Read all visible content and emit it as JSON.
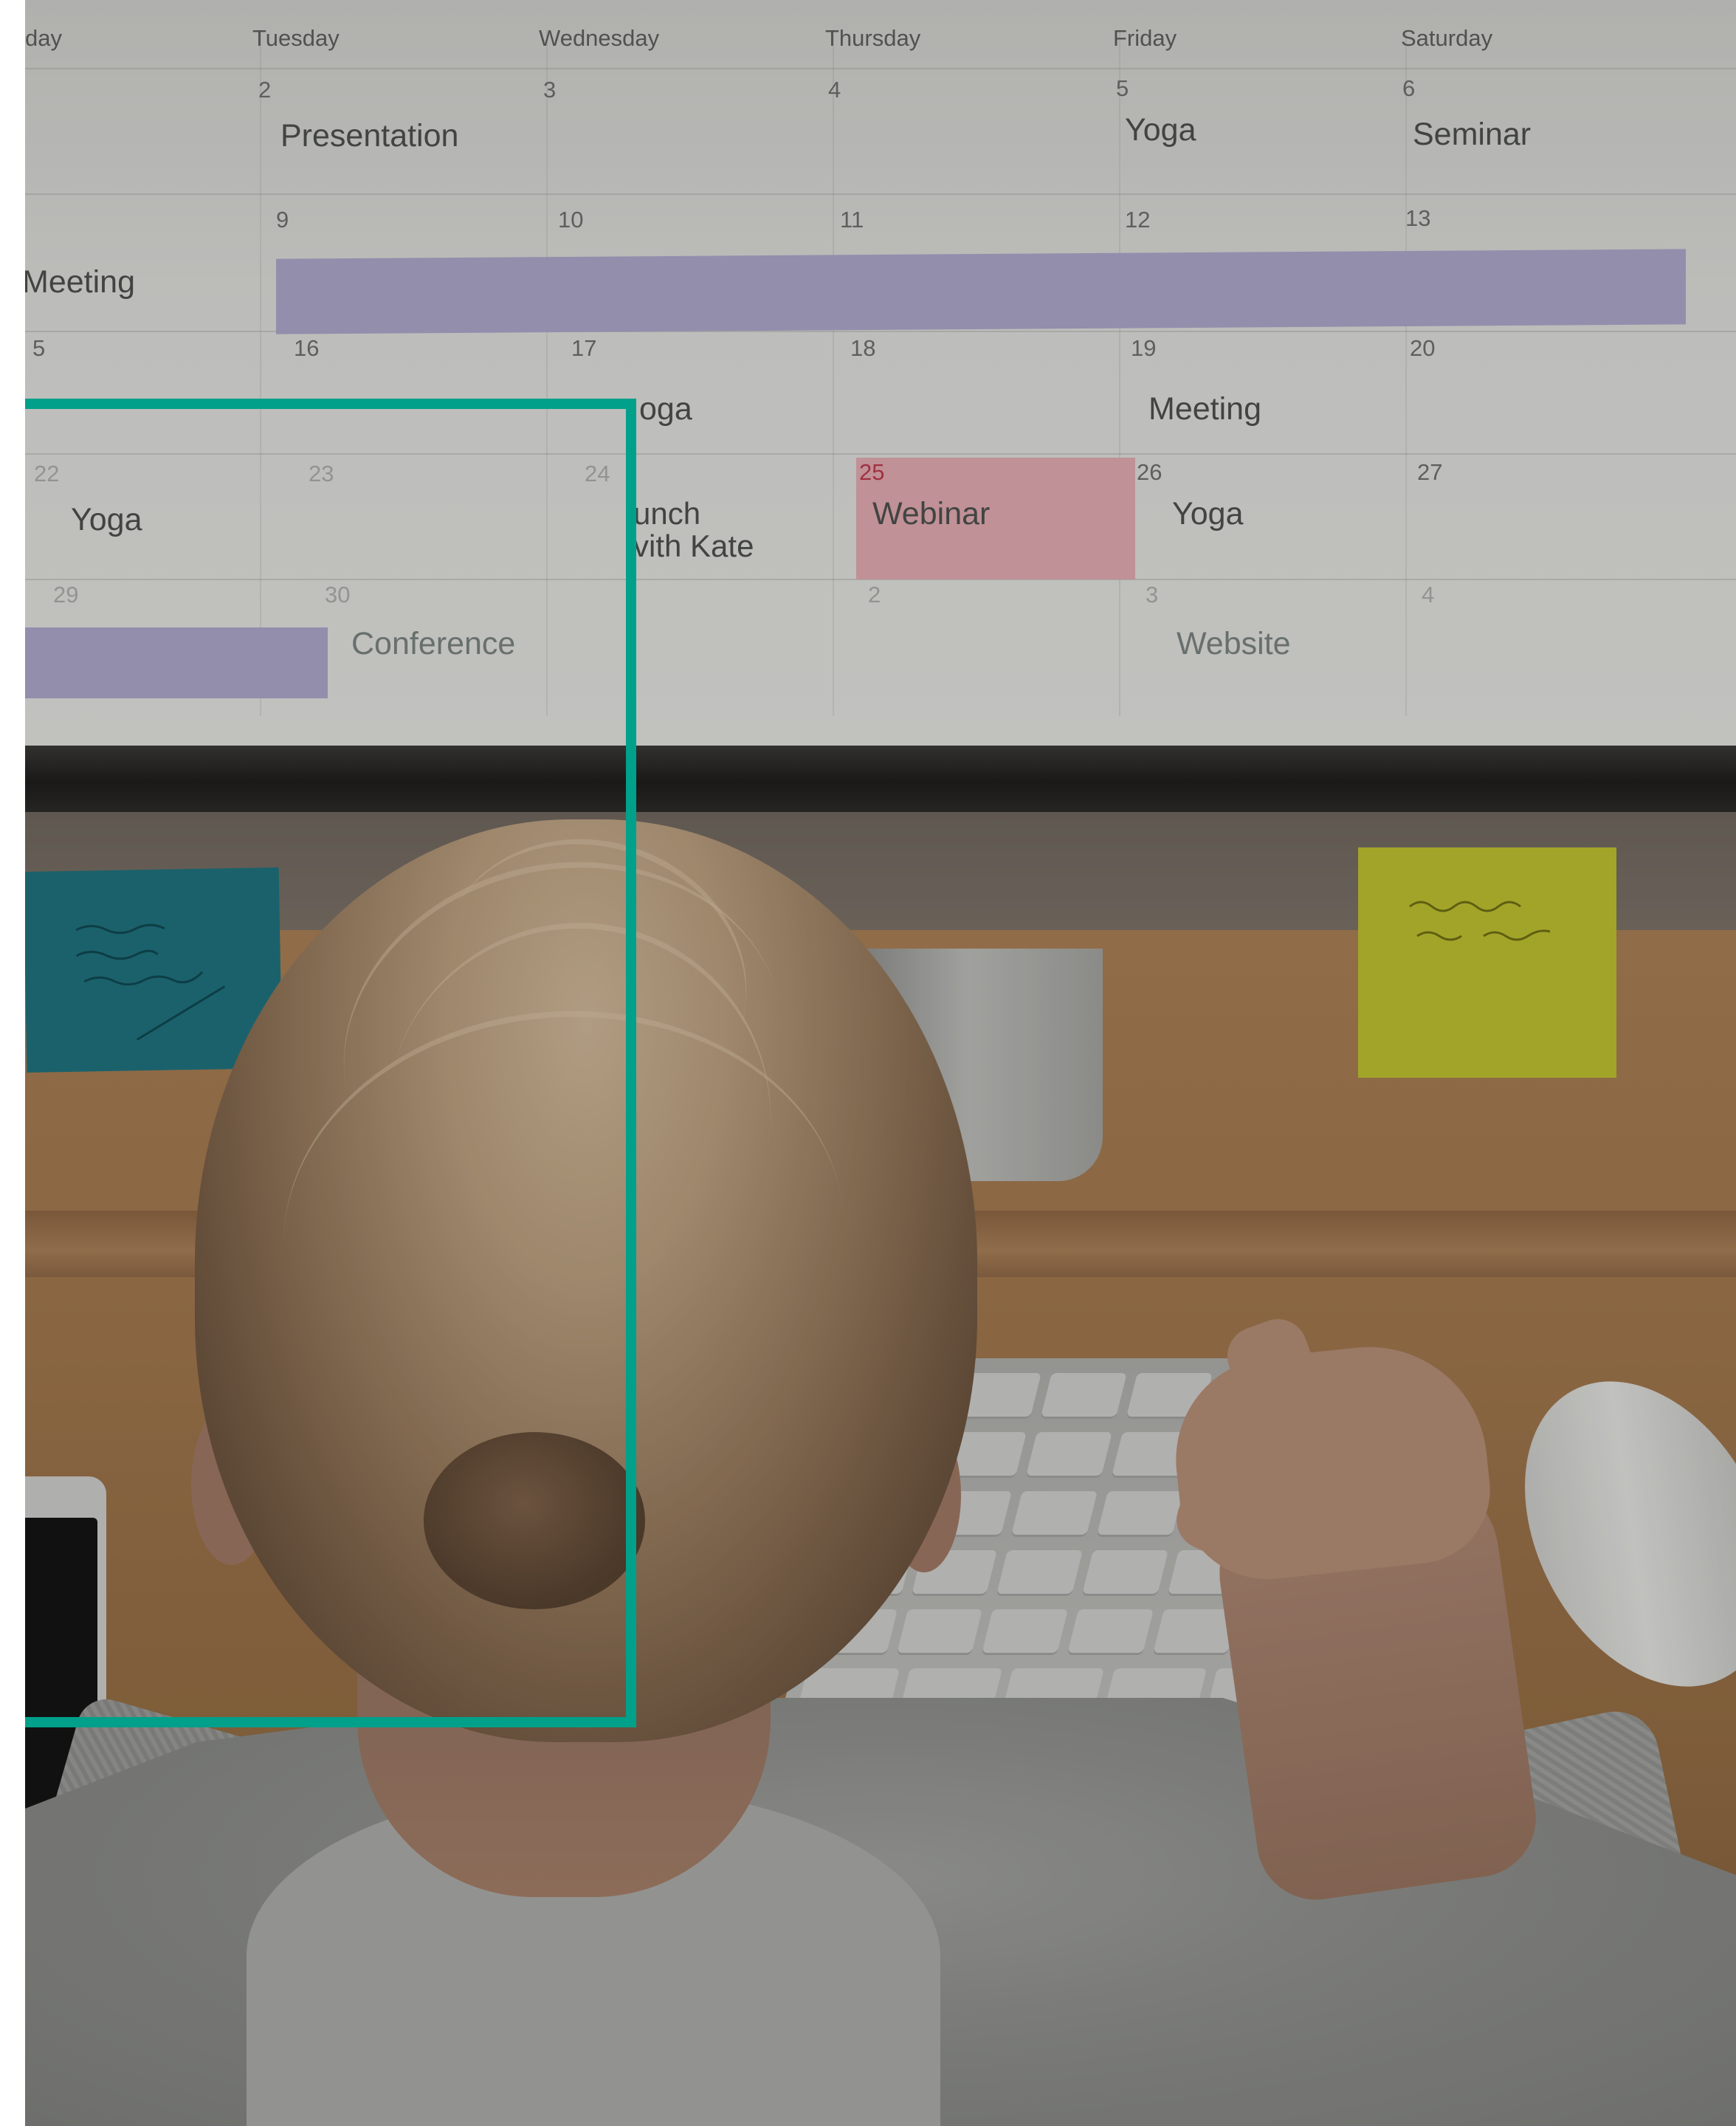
{
  "calendar": {
    "days": [
      "day",
      "Tuesday",
      "Wednesday",
      "Thursday",
      "Friday",
      "Saturday"
    ],
    "week1": {
      "dates": [
        "2",
        "3",
        "4",
        "5",
        "6"
      ],
      "events": {
        "tue": "Presentation",
        "fri": "Yoga",
        "sat": "Seminar"
      }
    },
    "week2": {
      "dates": [
        "9",
        "10",
        "11",
        "12",
        "13"
      ],
      "events": {
        "mon": "Meeting"
      }
    },
    "week3": {
      "dates": [
        "5",
        "16",
        "17",
        "18",
        "19",
        "20"
      ],
      "events": {
        "wed": "oga",
        "fri": "Meeting"
      }
    },
    "week4": {
      "dates": [
        "22",
        "23",
        "24",
        "25",
        "26",
        "27"
      ],
      "events": {
        "mon": "Yoga",
        "wed": "unch\nvith Kate",
        "thu": "Webinar",
        "fri": "Yoga"
      }
    },
    "week5": {
      "dates": [
        "29",
        "30",
        "2",
        "3",
        "4"
      ],
      "events": {
        "tue": "Conference",
        "fri": "Website"
      }
    }
  },
  "colors": {
    "frame_accent": "#00a08a",
    "event_bar": "#a8a2c4",
    "webinar_highlight": "#dba6ac"
  }
}
